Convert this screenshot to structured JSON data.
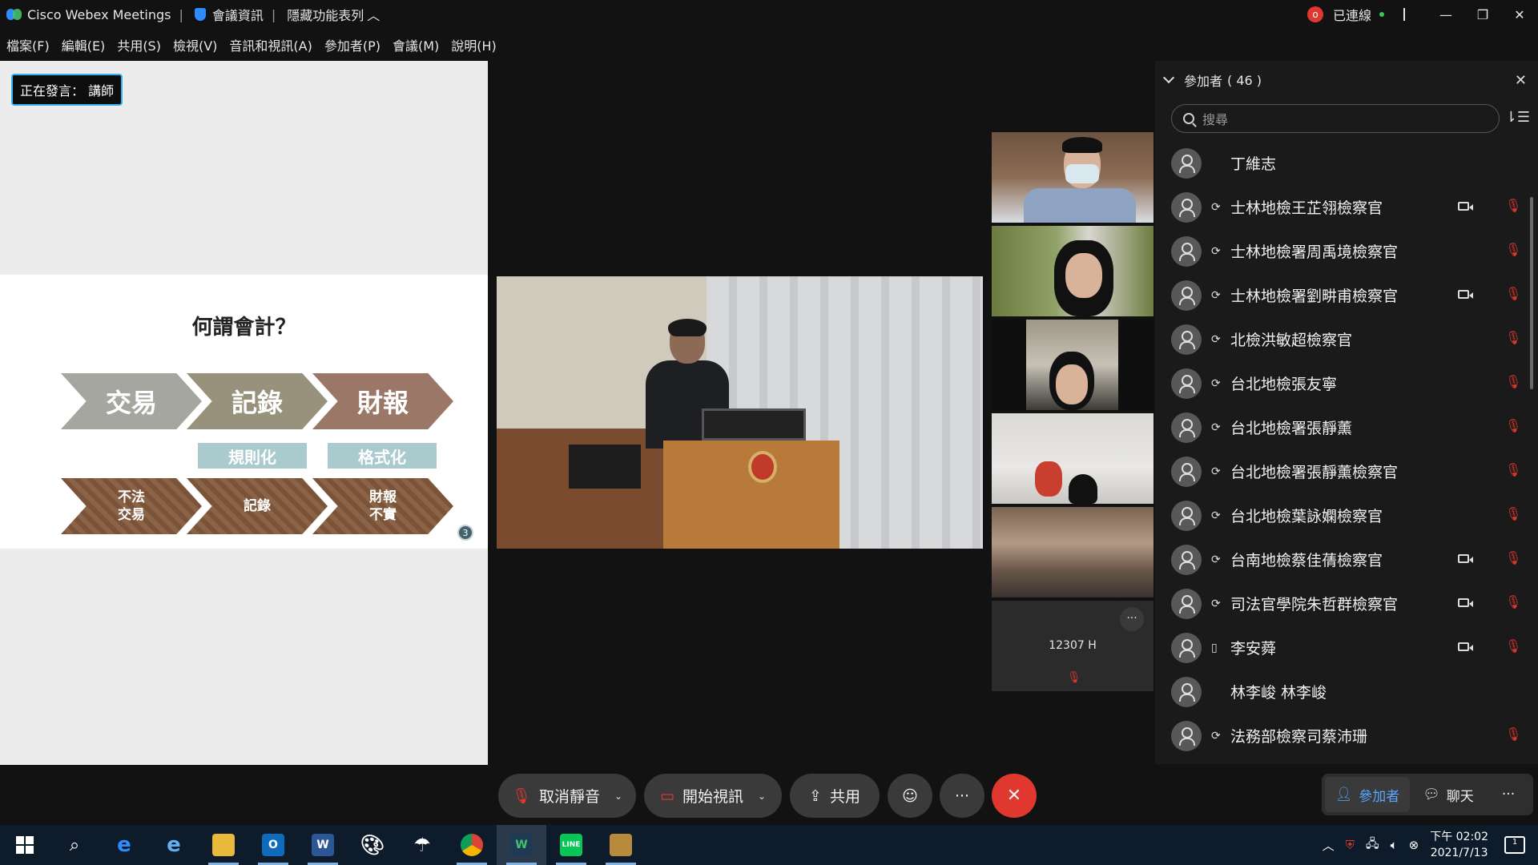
{
  "titlebar": {
    "app_title": "Cisco Webex Meetings",
    "meeting_info": "會議資訊",
    "hide_menu": "隱藏功能表列",
    "rec_badge": "o",
    "connected": "已連線"
  },
  "menu": [
    "檔案(F)",
    "編輯(E)",
    "共用(S)",
    "檢視(V)",
    "音訊和視訊(A)",
    "參加者(P)",
    "會議(M)",
    "說明(H)"
  ],
  "speaker": {
    "label": "正在發言：  講師"
  },
  "slide": {
    "title": "何謂會計？",
    "chevrons": [
      "交易",
      "記錄",
      "財報"
    ],
    "tags": [
      "規則化",
      "格式化"
    ],
    "bottom_chevrons": [
      "不法\n交易",
      "記錄",
      "財報\n不實"
    ],
    "page_number": "3"
  },
  "thumbnail_tile": {
    "name": "12307 H",
    "more": "···"
  },
  "participants_panel": {
    "title": "參加者",
    "count": "( 46 )",
    "search_placeholder": "搜尋",
    "participants": [
      {
        "name": "丁維志",
        "audio": "",
        "video": false,
        "muted": false
      },
      {
        "name": "士林地檢王芷翎檢察官",
        "audio": "⟳",
        "video": true,
        "muted": true
      },
      {
        "name": "士林地檢署周禹境檢察官",
        "audio": "⟳",
        "video": false,
        "muted": true
      },
      {
        "name": "士林地檢署劉畊甫檢察官",
        "audio": "⟳",
        "video": true,
        "muted": true
      },
      {
        "name": "北檢洪敏超檢察官",
        "audio": "⟳",
        "video": false,
        "muted": true
      },
      {
        "name": "台北地檢張友寧",
        "audio": "⟳",
        "video": false,
        "muted": true
      },
      {
        "name": "台北地檢署張靜薰",
        "audio": "⟳",
        "video": false,
        "muted": true
      },
      {
        "name": "台北地檢署張靜薰檢察官",
        "audio": "⟳",
        "video": false,
        "muted": true
      },
      {
        "name": "台北地檢葉詠嫻檢察官",
        "audio": "⟳",
        "video": false,
        "muted": true
      },
      {
        "name": "台南地檢蔡佳蒨檢察官",
        "audio": "⟳",
        "video": true,
        "muted": true
      },
      {
        "name": "司法官學院朱哲群檢察官",
        "audio": "⟳",
        "video": true,
        "muted": true
      },
      {
        "name": "李安蕣",
        "audio": "▯",
        "video": true,
        "muted": true
      },
      {
        "name": "林李峻 林李峻",
        "audio": "",
        "video": false,
        "muted": false
      },
      {
        "name": "法務部檢察司蔡沛珊",
        "audio": "⟳",
        "video": false,
        "muted": true
      }
    ]
  },
  "controls": {
    "unmute": "取消靜音",
    "start_video": "開始視訊",
    "share": "共用",
    "more": "···",
    "end": "✕"
  },
  "side_tabs": {
    "participants": "參加者",
    "chat": "聊天",
    "more": "···"
  },
  "taskbar": {
    "time": "下午 02:02",
    "date": "2021/7/13",
    "notifications": "1"
  },
  "colors": {
    "accent": "#36b3f0",
    "mute_red": "#e0382e",
    "panel_bg": "#1a1a1a"
  }
}
